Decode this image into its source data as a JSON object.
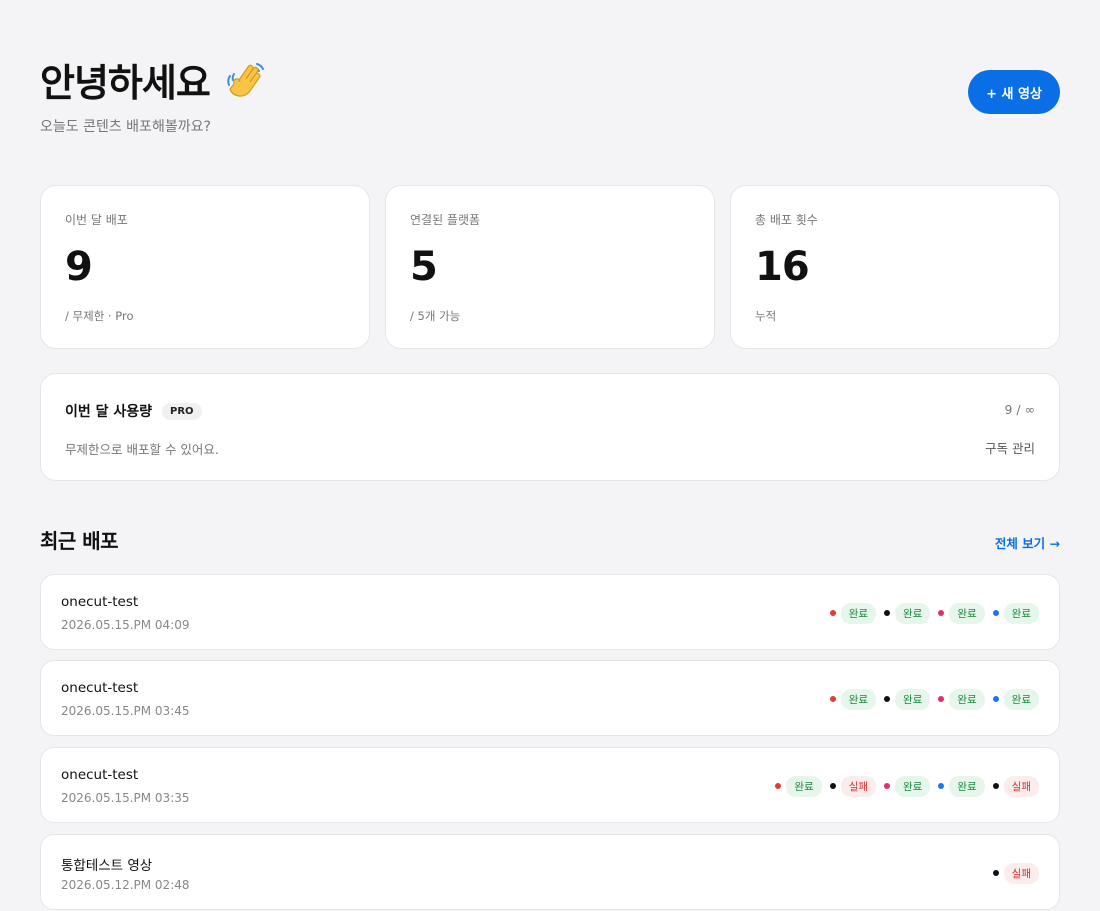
{
  "header": {
    "greeting": "안녕하세요",
    "subtitle": "오늘도 콘텐츠 배포해볼까요?",
    "new_button": "+ 새 영상"
  },
  "stats": [
    {
      "label": "이번 달 배포",
      "value": "9",
      "note": "/ 무제한 · Pro"
    },
    {
      "label": "연결된 플랫폼",
      "value": "5",
      "note": "/ 5개 가능"
    },
    {
      "label": "총 배포 횟수",
      "value": "16",
      "note": "누적"
    }
  ],
  "usage": {
    "title": "이번 달 사용량",
    "badge": "PRO",
    "description": "무제한으로 배포할 수 있어요.",
    "count": "9 / ∞",
    "manage_label": "구독 관리"
  },
  "recent": {
    "title": "최근 배포",
    "view_all": "전체 보기 →",
    "status_colors": {
      "youtube": "#e53935",
      "tiktok": "#111111",
      "instagram": "#e1306c",
      "facebook": "#1877f2",
      "threads": "#111111"
    },
    "items": [
      {
        "name": "onecut-test",
        "date": "2026.05.15.PM 04:09",
        "statuses": [
          {
            "platform": "youtube",
            "label": "완료",
            "state": "ok"
          },
          {
            "platform": "tiktok",
            "label": "완료",
            "state": "ok"
          },
          {
            "platform": "instagram",
            "label": "완료",
            "state": "ok"
          },
          {
            "platform": "facebook",
            "label": "완료",
            "state": "ok"
          }
        ]
      },
      {
        "name": "onecut-test",
        "date": "2026.05.15.PM 03:45",
        "statuses": [
          {
            "platform": "youtube",
            "label": "완료",
            "state": "ok"
          },
          {
            "platform": "tiktok",
            "label": "완료",
            "state": "ok"
          },
          {
            "platform": "instagram",
            "label": "완료",
            "state": "ok"
          },
          {
            "platform": "facebook",
            "label": "완료",
            "state": "ok"
          }
        ]
      },
      {
        "name": "onecut-test",
        "date": "2026.05.15.PM 03:35",
        "statuses": [
          {
            "platform": "youtube",
            "label": "완료",
            "state": "ok"
          },
          {
            "platform": "tiktok",
            "label": "실패",
            "state": "fail"
          },
          {
            "platform": "instagram",
            "label": "완료",
            "state": "ok"
          },
          {
            "platform": "facebook",
            "label": "완료",
            "state": "ok"
          },
          {
            "platform": "threads",
            "label": "실패",
            "state": "fail"
          }
        ]
      },
      {
        "name": "통합테스트 영상",
        "date": "2026.05.12.PM 02:48",
        "statuses": [
          {
            "platform": "threads",
            "label": "실패",
            "state": "fail"
          }
        ]
      }
    ]
  }
}
